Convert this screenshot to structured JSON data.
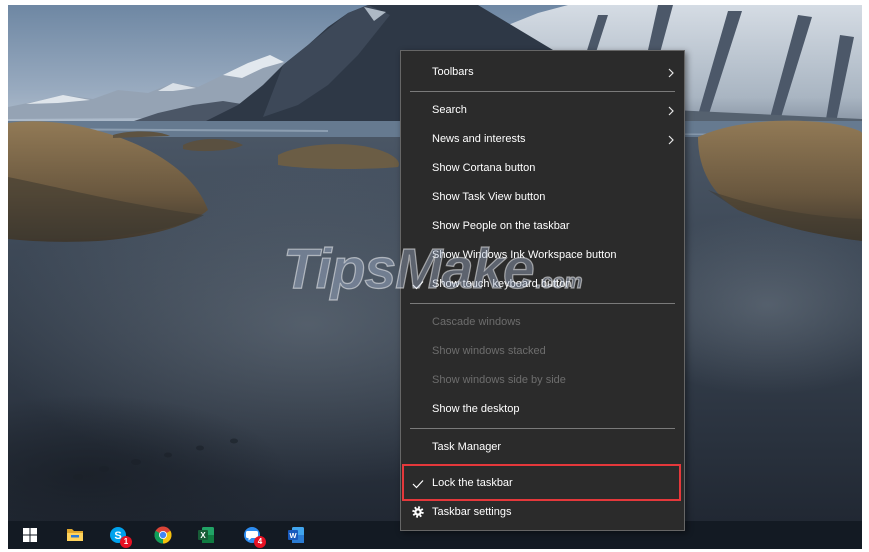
{
  "colors": {
    "menu_background": "#2b2b2b",
    "menu_text": "#ffffff",
    "menu_disabled_text": "#6d6d6d",
    "highlight_border": "#e5383b",
    "taskbar_background": "#131a23",
    "badge": "#e81123"
  },
  "watermark": {
    "main": "TipsMake",
    "suffix": ".com"
  },
  "context_menu": {
    "items": [
      {
        "label": "Toolbars",
        "submenu": true
      },
      {
        "label": "Search",
        "submenu": true
      },
      {
        "label": "News and interests",
        "submenu": true
      },
      {
        "label": "Show Cortana button"
      },
      {
        "label": "Show Task View button"
      },
      {
        "label": "Show People on the taskbar"
      },
      {
        "label": "Show Windows Ink Workspace button"
      },
      {
        "label": "Show touch keyboard button",
        "checked": true
      },
      {
        "label": "Cascade windows",
        "disabled": true
      },
      {
        "label": "Show windows stacked",
        "disabled": true
      },
      {
        "label": "Show windows side by side",
        "disabled": true
      },
      {
        "label": "Show the desktop"
      },
      {
        "label": "Task Manager"
      },
      {
        "label": "Lock the taskbar",
        "checked": true,
        "highlighted": true
      },
      {
        "label": "Taskbar settings",
        "icon": "gear-icon"
      }
    ]
  },
  "taskbar": {
    "apps": [
      {
        "icon": "windows-start-icon"
      },
      {
        "icon": "file-explorer-icon"
      },
      {
        "icon": "skype-icon",
        "letter": "S",
        "badge": "1"
      },
      {
        "icon": "chrome-icon"
      },
      {
        "icon": "excel-icon",
        "letter": "X"
      },
      {
        "icon": "chat-app-icon",
        "badge": "4"
      },
      {
        "icon": "word-icon",
        "letter": "W"
      }
    ]
  }
}
